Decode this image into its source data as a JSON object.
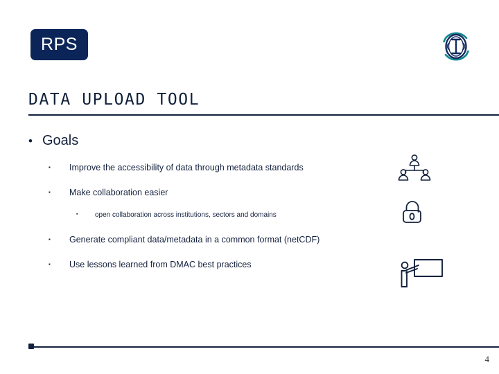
{
  "slide": {
    "title": "DATA UPLOAD TOOL",
    "page_number": "4",
    "accent_navy": "#0b2559",
    "rule_color": "#11203a",
    "text_color": "#14213d",
    "icon_teal": "#11868f",
    "background": "#ffffff"
  },
  "header": {
    "left_logo": {
      "name": "rps-logo",
      "text": "RPS",
      "background": "#0b2559",
      "text_color": "#ffffff"
    },
    "right_logo": {
      "name": "ioos-logo",
      "letter": "I",
      "arc_color": "#11868f",
      "ring_color": "#132a5e"
    }
  },
  "body": {
    "level1": {
      "bullet_glyph": "•",
      "label": "Goals"
    },
    "bullets": [
      {
        "level": 2,
        "glyph": "▪",
        "text": "Improve the accessibility of data through metadata standards"
      },
      {
        "level": 2,
        "glyph": "▪",
        "text": "Make collaboration easier"
      },
      {
        "level": 3,
        "glyph": "▪",
        "text": "open collaboration across institutions, sectors and domains"
      },
      {
        "level": 2,
        "glyph": "▪",
        "text": "Generate compliant data/metadata in a common format (netCDF)"
      },
      {
        "level": 2,
        "glyph": "▪",
        "text": "Use lessons learned from DMAC best practices"
      }
    ]
  },
  "decorative_icons": [
    {
      "name": "collaboration-network-icon",
      "description": "three connected person figures"
    },
    {
      "name": "open-padlock-icon",
      "description": "unlocked padlock with keyhole"
    },
    {
      "name": "presenter-whiteboard-icon",
      "description": "person pointing at a board"
    }
  ]
}
